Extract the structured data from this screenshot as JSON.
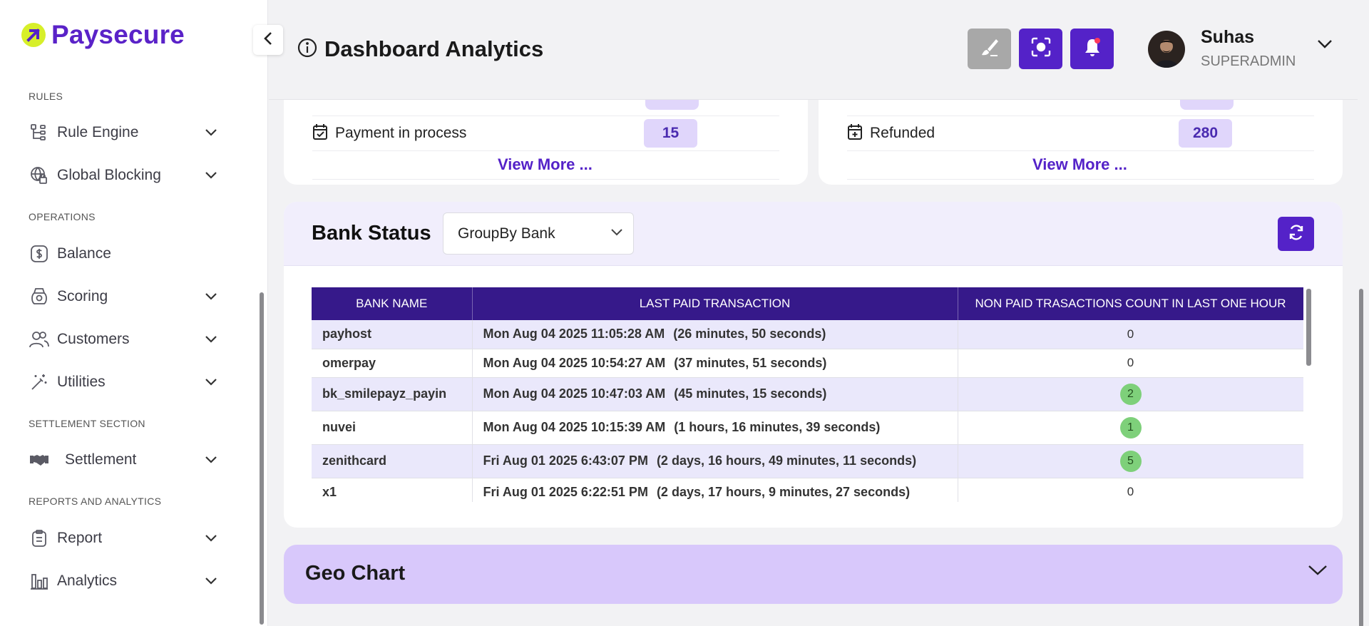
{
  "brand": {
    "name": "Paysecure",
    "accent": "#5422c8",
    "mark_color": "#d7ef2a"
  },
  "sidebar": {
    "sections": [
      {
        "label": "RULES",
        "items": [
          {
            "label": "Rule Engine",
            "icon": "rule-engine-icon",
            "expandable": true
          },
          {
            "label": "Global Blocking",
            "icon": "global-blocking-icon",
            "expandable": true
          }
        ]
      },
      {
        "label": "OPERATIONS",
        "items": [
          {
            "label": "Balance",
            "icon": "dollar-icon",
            "expandable": false
          },
          {
            "label": "Scoring",
            "icon": "scoring-icon",
            "expandable": true
          },
          {
            "label": "Customers",
            "icon": "users-icon",
            "expandable": true
          },
          {
            "label": "Utilities",
            "icon": "magic-wand-icon",
            "expandable": true
          }
        ]
      },
      {
        "label": "SETTLEMENT SECTION",
        "items": [
          {
            "label": "Settlement",
            "icon": "handshake-icon",
            "expandable": true
          }
        ]
      },
      {
        "label": "REPORTS AND ANALYTICS",
        "items": [
          {
            "label": "Report",
            "icon": "clipboard-icon",
            "expandable": true
          },
          {
            "label": "Analytics",
            "icon": "bar-chart-icon",
            "expandable": true
          }
        ]
      }
    ]
  },
  "header": {
    "title": "Dashboard Analytics",
    "buttons": [
      "brush-icon",
      "scan-icon",
      "bell-icon"
    ],
    "user": {
      "name": "Suhas",
      "role": "SUPERADMIN"
    }
  },
  "stats": {
    "left": {
      "label": "Payment in process",
      "value": "15",
      "view_more": "View More ..."
    },
    "right": {
      "label": "Refunded",
      "value": "280",
      "view_more": "View More ..."
    }
  },
  "bank_status": {
    "title": "Bank Status",
    "group_by": "GroupBy Bank",
    "columns": [
      "BANK NAME",
      "LAST PAID TRANSACTION",
      "NON PAID TRASACTIONS COUNT IN LAST ONE HOUR"
    ],
    "rows": [
      {
        "bank": "payhost",
        "last_paid": "Mon Aug 04 2025 11:05:28 AM",
        "ago": "(26 minutes, 50 seconds)",
        "count": "0",
        "highlight": false
      },
      {
        "bank": "omerpay",
        "last_paid": "Mon Aug 04 2025 10:54:27 AM",
        "ago": "(37 minutes, 51 seconds)",
        "count": "0",
        "highlight": false
      },
      {
        "bank": "bk_smilepayz_payin",
        "last_paid": "Mon Aug 04 2025 10:47:03 AM",
        "ago": "(45 minutes, 15 seconds)",
        "count": "2",
        "highlight": true
      },
      {
        "bank": "nuvei",
        "last_paid": "Mon Aug 04 2025 10:15:39 AM",
        "ago": "(1 hours, 16 minutes, 39 seconds)",
        "count": "1",
        "highlight": true
      },
      {
        "bank": "zenithcard",
        "last_paid": "Fri Aug 01 2025 6:43:07 PM",
        "ago": "(2 days, 16 hours, 49 minutes, 11 seconds)",
        "count": "5",
        "highlight": true
      },
      {
        "bank": "x1",
        "last_paid": "Fri Aug 01 2025 6:22:51 PM",
        "ago": "(2 days, 17 hours, 9 minutes, 27 seconds)",
        "count": "0",
        "highlight": false
      }
    ]
  },
  "geo_chart": {
    "title": "Geo Chart"
  }
}
